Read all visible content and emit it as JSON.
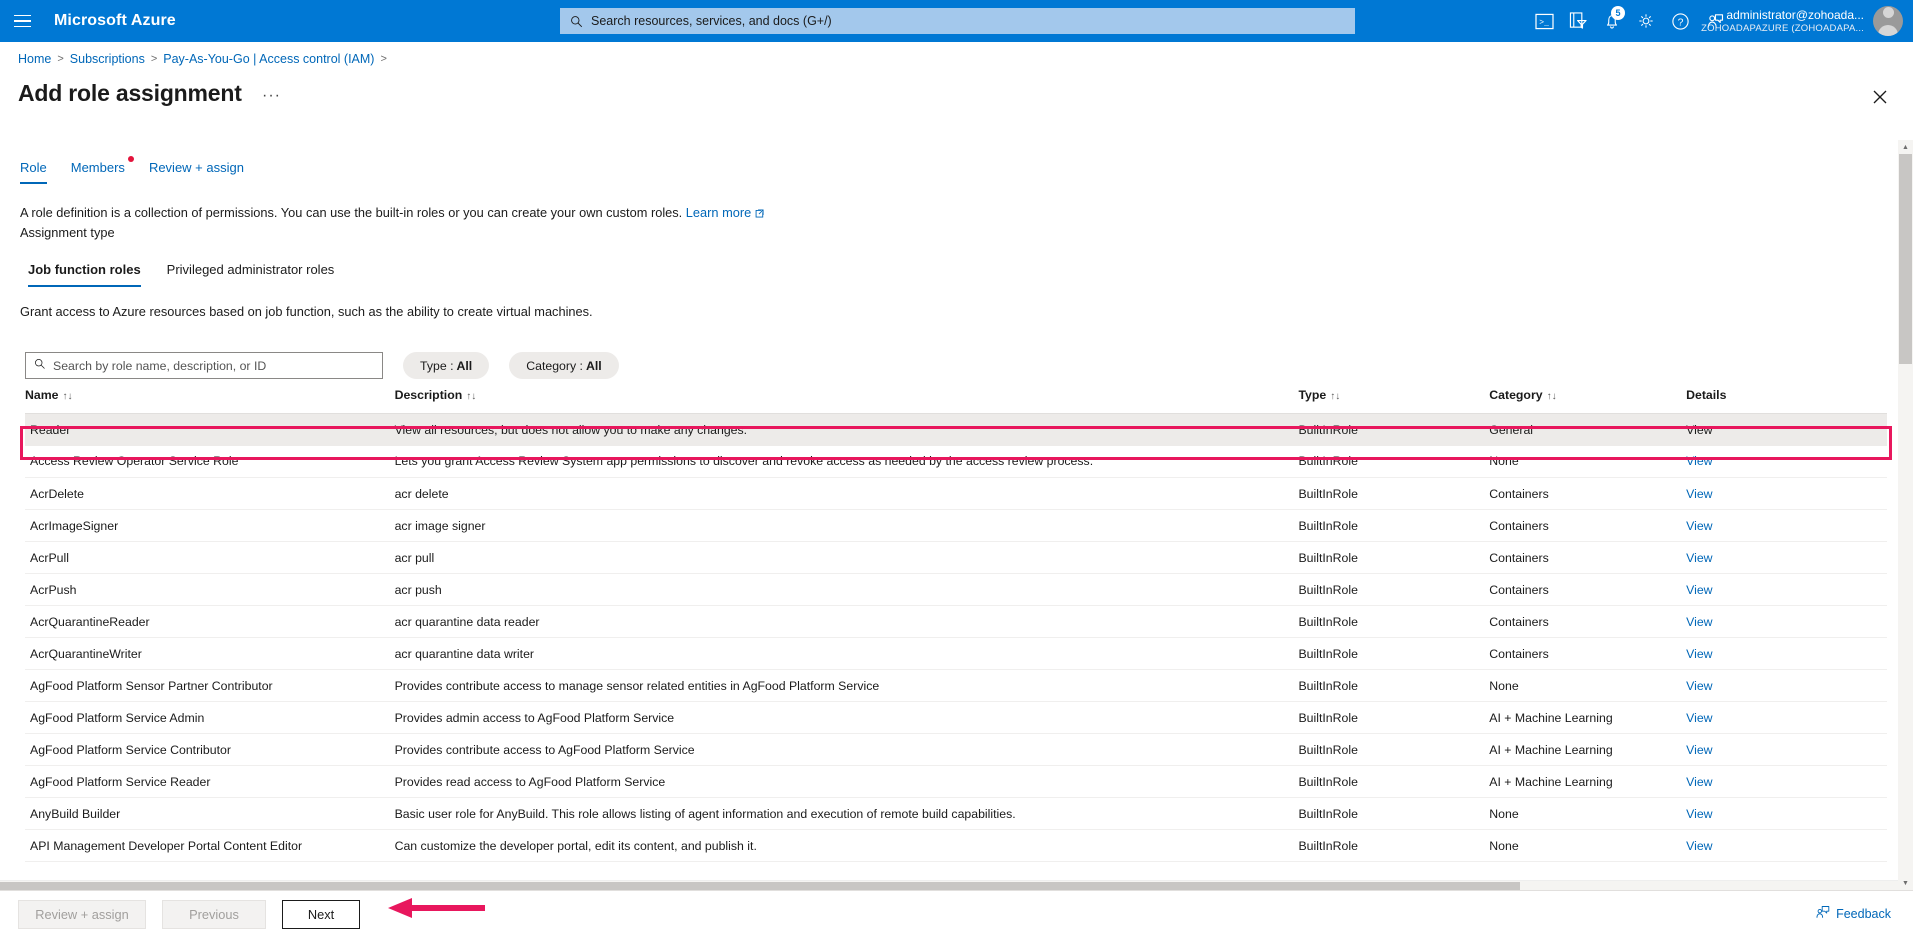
{
  "topbar": {
    "menu_icon": "hamburger-icon",
    "brand": "Microsoft Azure",
    "search_placeholder": "Search resources, services, and docs (G+/)",
    "icons": [
      {
        "name": "cloud-shell-icon",
        "glyph": ">_"
      },
      {
        "name": "directories-filter-icon",
        "glyph": "filter"
      },
      {
        "name": "notifications-icon",
        "glyph": "bell",
        "badge": "5"
      },
      {
        "name": "settings-gear-icon",
        "glyph": "gear"
      },
      {
        "name": "help-question-icon",
        "glyph": "?"
      },
      {
        "name": "feedback-icon",
        "glyph": "person-comment"
      }
    ],
    "account_name": "administrator@zohoada...",
    "account_org": "ZOHOADAPAZURE (ZOHOADAPA..."
  },
  "breadcrumb": {
    "items": [
      "Home",
      "Subscriptions",
      "Pay-As-You-Go | Access control (IAM)"
    ],
    "separator": ">"
  },
  "page": {
    "title": "Add role assignment",
    "ellipsis": "···",
    "close_icon": "close-icon"
  },
  "wizard_tabs": [
    {
      "label": "Role",
      "active": true,
      "has_dot": false
    },
    {
      "label": "Members",
      "active": false,
      "has_dot": true
    },
    {
      "label": "Review + assign",
      "active": false,
      "has_dot": false
    }
  ],
  "description": {
    "text": "A role definition is a collection of permissions. You can use the built-in roles or you can create your own custom roles.",
    "link": "Learn more",
    "link_icon": "external-link-icon",
    "assignment_type_label": "Assignment type"
  },
  "sub_tabs": [
    {
      "label": "Job function roles",
      "active": true
    },
    {
      "label": "Privileged administrator roles",
      "active": false
    }
  ],
  "grant_text": "Grant access to Azure resources based on job function, such as the ability to create virtual machines.",
  "filters": {
    "search_placeholder": "Search by role name, description, or ID",
    "search_icon": "search-icon",
    "pills": [
      {
        "label": "Type :",
        "value": "All"
      },
      {
        "label": "Category :",
        "value": "All"
      }
    ]
  },
  "table": {
    "columns": [
      {
        "key": "name",
        "label": "Name",
        "sortable": true
      },
      {
        "key": "description",
        "label": "Description",
        "sortable": true
      },
      {
        "key": "type",
        "label": "Type",
        "sortable": true
      },
      {
        "key": "category",
        "label": "Category",
        "sortable": true
      },
      {
        "key": "details",
        "label": "Details",
        "sortable": false
      }
    ],
    "sort_glyph": "↑↓",
    "rows": [
      {
        "name": "Reader",
        "description": "View all resources, but does not allow you to make any changes.",
        "type": "BuiltInRole",
        "category": "General",
        "details": "View",
        "selected": true
      },
      {
        "name": "Access Review Operator Service Role",
        "description": "Lets you grant Access Review System app permissions to discover and revoke access as needed by the access review process.",
        "type": "BuiltInRole",
        "category": "None",
        "details": "View",
        "selected": false
      },
      {
        "name": "AcrDelete",
        "description": "acr delete",
        "type": "BuiltInRole",
        "category": "Containers",
        "details": "View",
        "selected": false
      },
      {
        "name": "AcrImageSigner",
        "description": "acr image signer",
        "type": "BuiltInRole",
        "category": "Containers",
        "details": "View",
        "selected": false
      },
      {
        "name": "AcrPull",
        "description": "acr pull",
        "type": "BuiltInRole",
        "category": "Containers",
        "details": "View",
        "selected": false
      },
      {
        "name": "AcrPush",
        "description": "acr push",
        "type": "BuiltInRole",
        "category": "Containers",
        "details": "View",
        "selected": false
      },
      {
        "name": "AcrQuarantineReader",
        "description": "acr quarantine data reader",
        "type": "BuiltInRole",
        "category": "Containers",
        "details": "View",
        "selected": false
      },
      {
        "name": "AcrQuarantineWriter",
        "description": "acr quarantine data writer",
        "type": "BuiltInRole",
        "category": "Containers",
        "details": "View",
        "selected": false
      },
      {
        "name": "AgFood Platform Sensor Partner Contributor",
        "description": "Provides contribute access to manage sensor related entities in AgFood Platform Service",
        "type": "BuiltInRole",
        "category": "None",
        "details": "View",
        "selected": false
      },
      {
        "name": "AgFood Platform Service Admin",
        "description": "Provides admin access to AgFood Platform Service",
        "type": "BuiltInRole",
        "category": "AI + Machine Learning",
        "details": "View",
        "selected": false
      },
      {
        "name": "AgFood Platform Service Contributor",
        "description": "Provides contribute access to AgFood Platform Service",
        "type": "BuiltInRole",
        "category": "AI + Machine Learning",
        "details": "View",
        "selected": false
      },
      {
        "name": "AgFood Platform Service Reader",
        "description": "Provides read access to AgFood Platform Service",
        "type": "BuiltInRole",
        "category": "AI + Machine Learning",
        "details": "View",
        "selected": false
      },
      {
        "name": "AnyBuild Builder",
        "description": "Basic user role for AnyBuild. This role allows listing of agent information and execution of remote build capabilities.",
        "type": "BuiltInRole",
        "category": "None",
        "details": "View",
        "selected": false
      },
      {
        "name": "API Management Developer Portal Content Editor",
        "description": "Can customize the developer portal, edit its content, and publish it.",
        "type": "BuiltInRole",
        "category": "None",
        "details": "View",
        "selected": false
      }
    ]
  },
  "footer": {
    "buttons": [
      {
        "label": "Review + assign",
        "state": "disabled"
      },
      {
        "label": "Previous",
        "state": "disabled"
      },
      {
        "label": "Next",
        "state": "enabled"
      }
    ],
    "feedback_label": "Feedback",
    "feedback_icon": "feedback-icon"
  },
  "annotations": {
    "highlight_color": "#e8175d",
    "arrow_color": "#e8175d",
    "arrow_points_to": "Next"
  },
  "colors": {
    "azure_blue": "#0078d4",
    "link_blue": "#0067b8",
    "selected_row": "#edebe9",
    "accent_pink": "#e8175d"
  }
}
